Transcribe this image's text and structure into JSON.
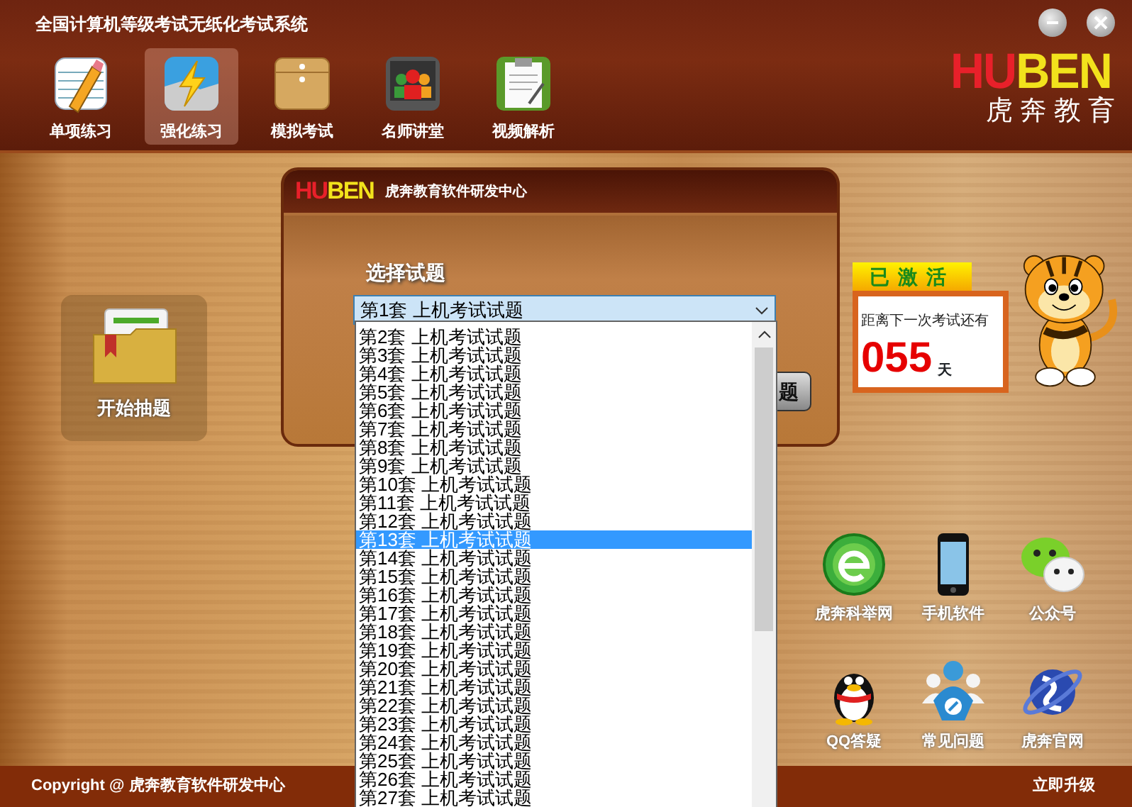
{
  "window": {
    "title": "全国计算机等级考试无纸化考试系统"
  },
  "toolbar": [
    {
      "label": "单项练习",
      "kind": "notepad",
      "selected": false
    },
    {
      "label": "强化练习",
      "kind": "lightning",
      "selected": true
    },
    {
      "label": "模拟考试",
      "kind": "envelope",
      "selected": false
    },
    {
      "label": "名师讲堂",
      "kind": "classroom",
      "selected": false
    },
    {
      "label": "视频解析",
      "kind": "clipboard",
      "selected": false
    }
  ],
  "logo": {
    "brand_parts": [
      {
        "text": "HU",
        "color": "#e8202a"
      },
      {
        "text": "BEN",
        "color": "#f2e21c"
      }
    ],
    "name": "虎奔教育"
  },
  "start_tile": {
    "label": "开始抽题"
  },
  "dialog": {
    "brand_parts": [
      {
        "text": "HU",
        "color": "#e8202a"
      },
      {
        "text": "BEN",
        "color": "#f2e21c"
      }
    ],
    "title": "虎奔教育软件研发中心",
    "label": "选择试题",
    "select": {
      "value": "第1套 上机考试试题",
      "expanded": true
    },
    "button": "题",
    "options": [
      {
        "label": "第2套 上机考试试题",
        "selected": false
      },
      {
        "label": "第3套 上机考试试题",
        "selected": false
      },
      {
        "label": "第4套 上机考试试题",
        "selected": false
      },
      {
        "label": "第5套 上机考试试题",
        "selected": false
      },
      {
        "label": "第6套 上机考试试题",
        "selected": false
      },
      {
        "label": "第7套 上机考试试题",
        "selected": false
      },
      {
        "label": "第8套 上机考试试题",
        "selected": false
      },
      {
        "label": "第9套 上机考试试题",
        "selected": false
      },
      {
        "label": "第10套 上机考试试题",
        "selected": false
      },
      {
        "label": "第11套 上机考试试题",
        "selected": false
      },
      {
        "label": "第12套 上机考试试题",
        "selected": false
      },
      {
        "label": "第13套 上机考试试题",
        "selected": true
      },
      {
        "label": "第14套 上机考试试题",
        "selected": false
      },
      {
        "label": "第15套 上机考试试题",
        "selected": false
      },
      {
        "label": "第16套 上机考试试题",
        "selected": false
      },
      {
        "label": "第17套 上机考试试题",
        "selected": false
      },
      {
        "label": "第18套 上机考试试题",
        "selected": false
      },
      {
        "label": "第19套 上机考试试题",
        "selected": false
      },
      {
        "label": "第20套 上机考试试题",
        "selected": false
      },
      {
        "label": "第21套 上机考试试题",
        "selected": false
      },
      {
        "label": "第22套 上机考试试题",
        "selected": false
      },
      {
        "label": "第23套 上机考试试题",
        "selected": false
      },
      {
        "label": "第24套 上机考试试题",
        "selected": false
      },
      {
        "label": "第25套 上机考试试题",
        "selected": false
      },
      {
        "label": "第26套 上机考试试题",
        "selected": false
      },
      {
        "label": "第27套 上机考试试题",
        "selected": false
      }
    ]
  },
  "activation": {
    "status": "已激活",
    "caption": "距离下一次考试还有",
    "days": "055",
    "unit": "天"
  },
  "links": [
    {
      "label": "虎奔科举网",
      "kind": "letter-e"
    },
    {
      "label": "手机软件",
      "kind": "phone"
    },
    {
      "label": "公众号",
      "kind": "chat"
    },
    {
      "label": "QQ答疑",
      "kind": "penguin"
    },
    {
      "label": "常见问题",
      "kind": "users"
    },
    {
      "label": "虎奔官网",
      "kind": "planet"
    }
  ],
  "footer": {
    "copyright": "Copyright @ 虎奔教育软件研发中心",
    "upgrade": "立即升级"
  }
}
